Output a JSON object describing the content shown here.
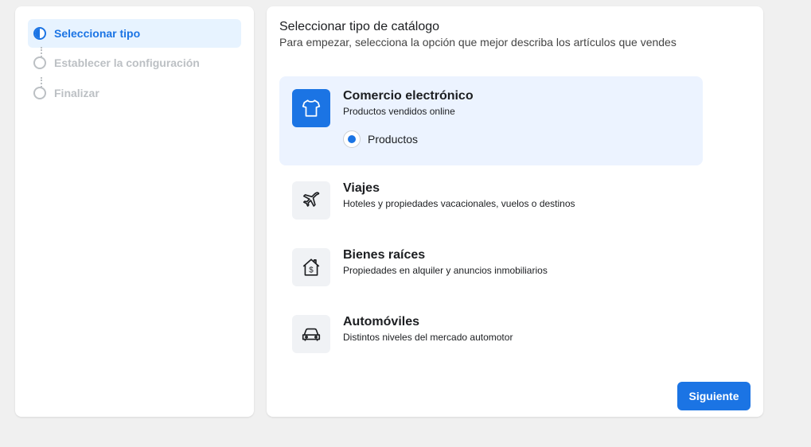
{
  "steps": [
    {
      "label": "Seleccionar tipo",
      "state": "active"
    },
    {
      "label": "Establecer la configuración",
      "state": "pending"
    },
    {
      "label": "Finalizar",
      "state": "pending"
    }
  ],
  "main": {
    "title": "Seleccionar tipo de catálogo",
    "subtitle": "Para empezar, selecciona la opción que mejor describa los artículos que vendes"
  },
  "options": [
    {
      "title": "Comercio electrónico",
      "description": "Productos vendidos online",
      "icon": "tshirt-icon",
      "selected": true,
      "suboption": {
        "label": "Productos",
        "checked": true
      }
    },
    {
      "title": "Viajes",
      "description": "Hoteles y propiedades vacacionales, vuelos o destinos",
      "icon": "airplane-icon",
      "selected": false
    },
    {
      "title": "Bienes raíces",
      "description": "Propiedades en alquiler y anuncios inmobiliarios",
      "icon": "house-dollar-icon",
      "selected": false
    },
    {
      "title": "Automóviles",
      "description": "Distintos niveles del mercado automotor",
      "icon": "car-icon",
      "selected": false
    }
  ],
  "next_button": "Siguiente",
  "colors": {
    "accent": "#1b74e4",
    "selected_bg": "#ecf3ff",
    "page_bg": "#f0f0f0"
  }
}
